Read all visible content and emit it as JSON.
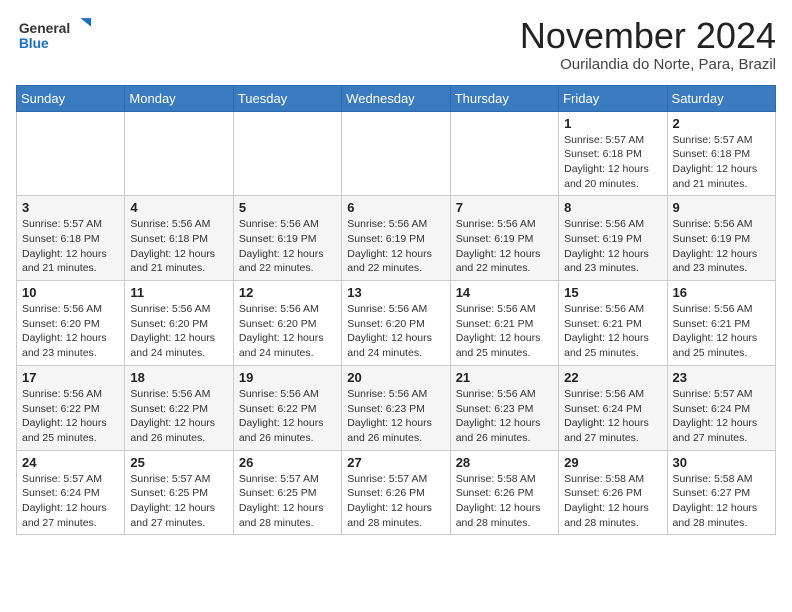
{
  "logo": {
    "general": "General",
    "blue": "Blue"
  },
  "title": "November 2024",
  "location": "Ourilandia do Norte, Para, Brazil",
  "weekdays": [
    "Sunday",
    "Monday",
    "Tuesday",
    "Wednesday",
    "Thursday",
    "Friday",
    "Saturday"
  ],
  "weeks": [
    [
      {
        "day": "",
        "info": ""
      },
      {
        "day": "",
        "info": ""
      },
      {
        "day": "",
        "info": ""
      },
      {
        "day": "",
        "info": ""
      },
      {
        "day": "",
        "info": ""
      },
      {
        "day": "1",
        "info": "Sunrise: 5:57 AM\nSunset: 6:18 PM\nDaylight: 12 hours and 20 minutes."
      },
      {
        "day": "2",
        "info": "Sunrise: 5:57 AM\nSunset: 6:18 PM\nDaylight: 12 hours and 21 minutes."
      }
    ],
    [
      {
        "day": "3",
        "info": "Sunrise: 5:57 AM\nSunset: 6:18 PM\nDaylight: 12 hours and 21 minutes."
      },
      {
        "day": "4",
        "info": "Sunrise: 5:56 AM\nSunset: 6:18 PM\nDaylight: 12 hours and 21 minutes."
      },
      {
        "day": "5",
        "info": "Sunrise: 5:56 AM\nSunset: 6:19 PM\nDaylight: 12 hours and 22 minutes."
      },
      {
        "day": "6",
        "info": "Sunrise: 5:56 AM\nSunset: 6:19 PM\nDaylight: 12 hours and 22 minutes."
      },
      {
        "day": "7",
        "info": "Sunrise: 5:56 AM\nSunset: 6:19 PM\nDaylight: 12 hours and 22 minutes."
      },
      {
        "day": "8",
        "info": "Sunrise: 5:56 AM\nSunset: 6:19 PM\nDaylight: 12 hours and 23 minutes."
      },
      {
        "day": "9",
        "info": "Sunrise: 5:56 AM\nSunset: 6:19 PM\nDaylight: 12 hours and 23 minutes."
      }
    ],
    [
      {
        "day": "10",
        "info": "Sunrise: 5:56 AM\nSunset: 6:20 PM\nDaylight: 12 hours and 23 minutes."
      },
      {
        "day": "11",
        "info": "Sunrise: 5:56 AM\nSunset: 6:20 PM\nDaylight: 12 hours and 24 minutes."
      },
      {
        "day": "12",
        "info": "Sunrise: 5:56 AM\nSunset: 6:20 PM\nDaylight: 12 hours and 24 minutes."
      },
      {
        "day": "13",
        "info": "Sunrise: 5:56 AM\nSunset: 6:20 PM\nDaylight: 12 hours and 24 minutes."
      },
      {
        "day": "14",
        "info": "Sunrise: 5:56 AM\nSunset: 6:21 PM\nDaylight: 12 hours and 25 minutes."
      },
      {
        "day": "15",
        "info": "Sunrise: 5:56 AM\nSunset: 6:21 PM\nDaylight: 12 hours and 25 minutes."
      },
      {
        "day": "16",
        "info": "Sunrise: 5:56 AM\nSunset: 6:21 PM\nDaylight: 12 hours and 25 minutes."
      }
    ],
    [
      {
        "day": "17",
        "info": "Sunrise: 5:56 AM\nSunset: 6:22 PM\nDaylight: 12 hours and 25 minutes."
      },
      {
        "day": "18",
        "info": "Sunrise: 5:56 AM\nSunset: 6:22 PM\nDaylight: 12 hours and 26 minutes."
      },
      {
        "day": "19",
        "info": "Sunrise: 5:56 AM\nSunset: 6:22 PM\nDaylight: 12 hours and 26 minutes."
      },
      {
        "day": "20",
        "info": "Sunrise: 5:56 AM\nSunset: 6:23 PM\nDaylight: 12 hours and 26 minutes."
      },
      {
        "day": "21",
        "info": "Sunrise: 5:56 AM\nSunset: 6:23 PM\nDaylight: 12 hours and 26 minutes."
      },
      {
        "day": "22",
        "info": "Sunrise: 5:56 AM\nSunset: 6:24 PM\nDaylight: 12 hours and 27 minutes."
      },
      {
        "day": "23",
        "info": "Sunrise: 5:57 AM\nSunset: 6:24 PM\nDaylight: 12 hours and 27 minutes."
      }
    ],
    [
      {
        "day": "24",
        "info": "Sunrise: 5:57 AM\nSunset: 6:24 PM\nDaylight: 12 hours and 27 minutes."
      },
      {
        "day": "25",
        "info": "Sunrise: 5:57 AM\nSunset: 6:25 PM\nDaylight: 12 hours and 27 minutes."
      },
      {
        "day": "26",
        "info": "Sunrise: 5:57 AM\nSunset: 6:25 PM\nDaylight: 12 hours and 28 minutes."
      },
      {
        "day": "27",
        "info": "Sunrise: 5:57 AM\nSunset: 6:26 PM\nDaylight: 12 hours and 28 minutes."
      },
      {
        "day": "28",
        "info": "Sunrise: 5:58 AM\nSunset: 6:26 PM\nDaylight: 12 hours and 28 minutes."
      },
      {
        "day": "29",
        "info": "Sunrise: 5:58 AM\nSunset: 6:26 PM\nDaylight: 12 hours and 28 minutes."
      },
      {
        "day": "30",
        "info": "Sunrise: 5:58 AM\nSunset: 6:27 PM\nDaylight: 12 hours and 28 minutes."
      }
    ]
  ]
}
